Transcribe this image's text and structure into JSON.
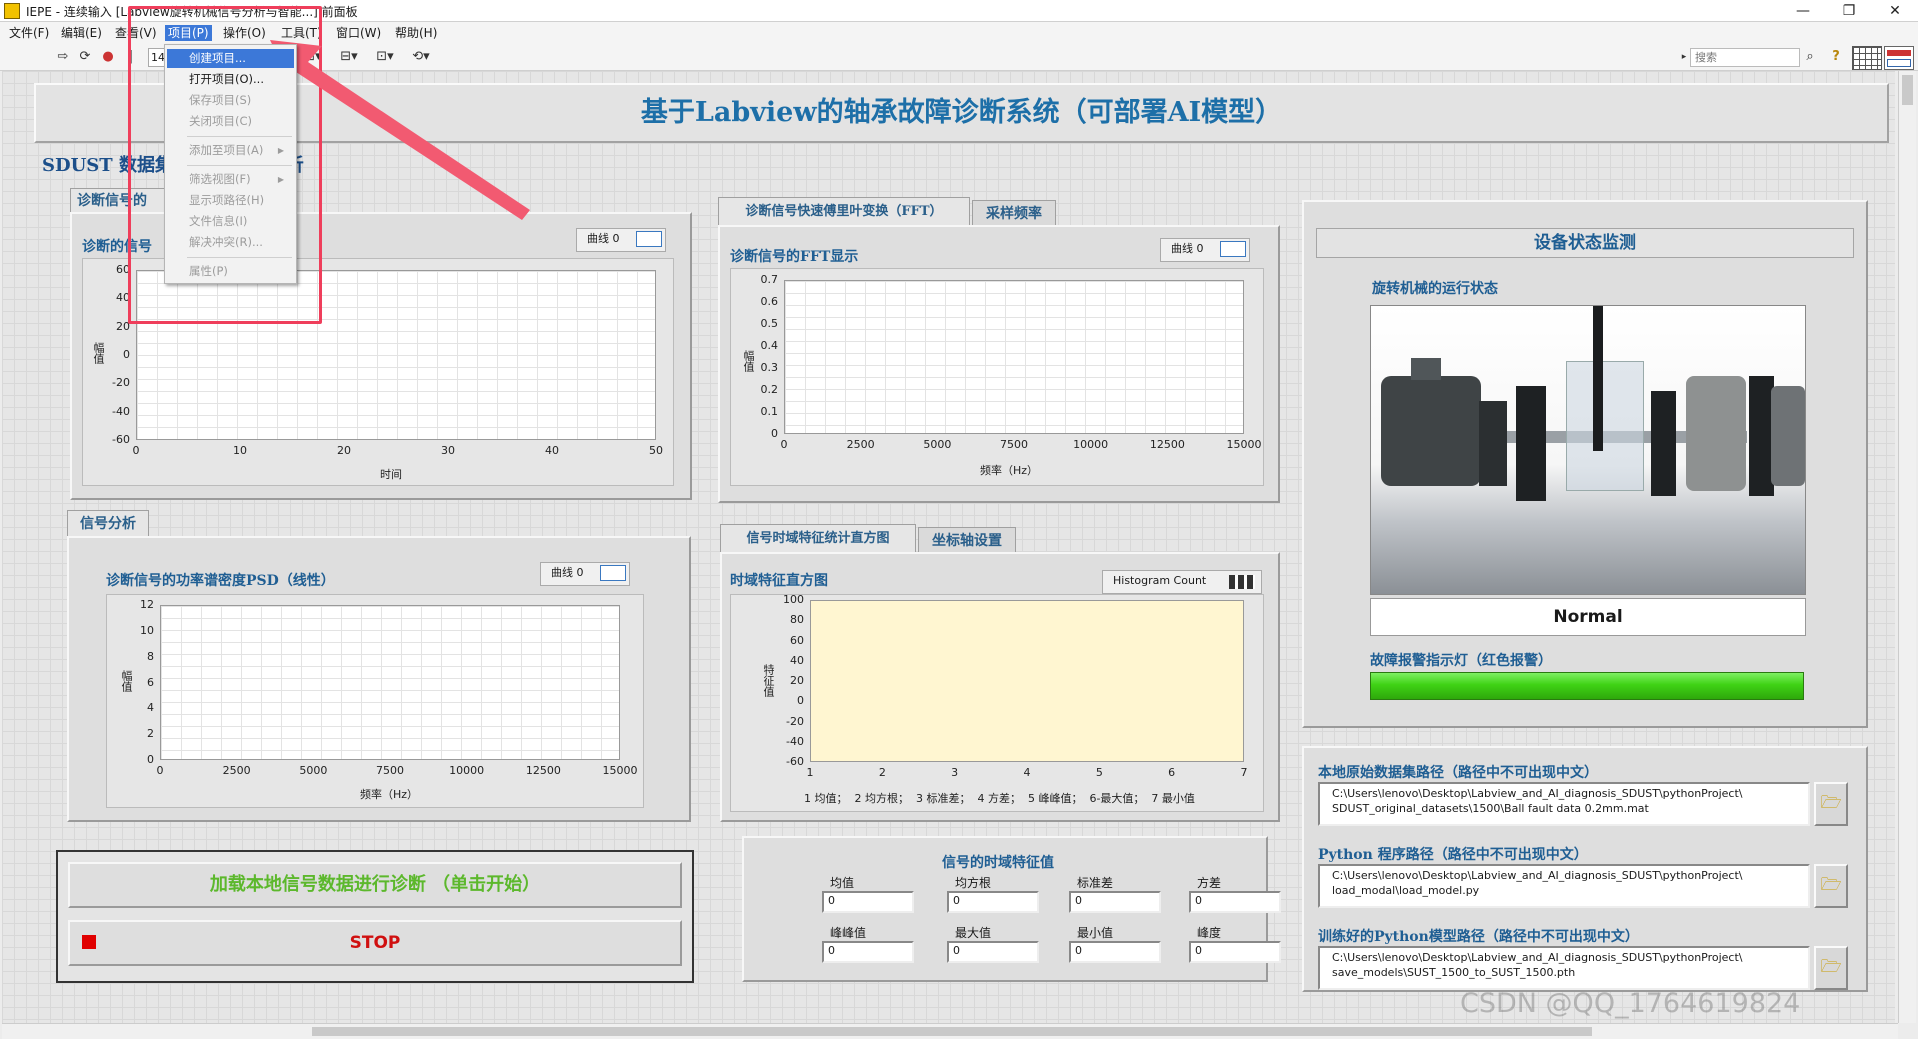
{
  "window": {
    "title": "IEPE - 连续输入 [Labview旋转机械信号分析与智能...] 前面板",
    "controls": [
      "—",
      "❐",
      "✕"
    ]
  },
  "menubar": {
    "items": [
      "文件(F)",
      "编辑(E)",
      "查看(V)",
      "项目(P)",
      "操作(O)",
      "工具(T)",
      "窗口(W)",
      "帮助(H)"
    ]
  },
  "toolbar": {
    "font_size_value": "14",
    "search_placeholder": "搜索",
    "help": "?"
  },
  "project_menu": {
    "items": [
      {
        "label": "创建项目...",
        "state": "highlighted"
      },
      {
        "label": "打开项目(O)...",
        "state": "enabled"
      },
      {
        "label": "保存项目(S)",
        "state": "disabled"
      },
      {
        "label": "关闭项目(C)",
        "state": "disabled"
      },
      {
        "label": "添加至项目(A)",
        "state": "disabled",
        "submenu": true
      },
      {
        "label": "筛选视图(F)",
        "state": "disabled",
        "submenu": true
      },
      {
        "label": "显示项路径(H)",
        "state": "disabled"
      },
      {
        "label": "文件信息(I)",
        "state": "disabled"
      },
      {
        "label": "解决冲突(R)...",
        "state": "disabled"
      },
      {
        "label": "属性(P)",
        "state": "disabled"
      }
    ]
  },
  "banner": {
    "title": "基于Labview的轴承故障诊断系统（可部署AI模型）"
  },
  "section_label": "SDUST 数据集                  析",
  "left_panel": {
    "tab_label": "诊断信号的",
    "chart_title": "诊断的信号",
    "legend": "曲线 0",
    "y_label": "幅值",
    "x_label": "时间"
  },
  "fft_panel": {
    "tabs": [
      "诊断信号快速傅里叶变换（FFT）",
      "采样频率"
    ],
    "chart_title": "诊断信号的FFT显示",
    "legend": "曲线 0",
    "y_label": "幅值",
    "x_label": "频率（Hz）"
  },
  "psd_panel": {
    "tab_label": "信号分析",
    "chart_title": "诊断信号的功率谱密度PSD（线性）",
    "legend": "曲线 0",
    "y_label": "幅值",
    "x_label": "频率（Hz）"
  },
  "hist_panel": {
    "tabs": [
      "信号时域特征统计直方图",
      "坐标轴设置"
    ],
    "chart_title": "时域特征直方图",
    "legend": "Histogram Count",
    "y_label": "特征值",
    "x_names": "1 均值；  2 均方根；  3 标准差；  4 方差；  5 峰峰值；  6-最大值；  7 最小值"
  },
  "action": {
    "load_button": "加载本地信号数据进行诊断 （单击开始）",
    "stop_button": "STOP"
  },
  "features": {
    "title": "信号的时域特征值",
    "fields": [
      {
        "label": "均值",
        "value": "0"
      },
      {
        "label": "均方根",
        "value": "0"
      },
      {
        "label": "标准差",
        "value": "0"
      },
      {
        "label": "方差",
        "value": "0"
      },
      {
        "label": "峰峰值",
        "value": "0"
      },
      {
        "label": "最大值",
        "value": "0"
      },
      {
        "label": "最小值",
        "value": "0"
      },
      {
        "label": "峰度",
        "value": "0"
      }
    ]
  },
  "monitor": {
    "title": "设备状态监测",
    "subtitle": "旋转机械的运行状态",
    "status": "Normal",
    "alarm_label": "故障报警指示灯（红色报警）",
    "alarm_color": "#3fd215"
  },
  "paths": [
    {
      "label": "本地原始数据集路径（路径中不可出现中文）",
      "line1": "C:\\Users\\lenovo\\Desktop\\Labview_and_AI_diagnosis_SDUST\\pythonProject\\",
      "line2": "SDUST_original_datasets\\1500\\Ball fault data 0.2mm.mat"
    },
    {
      "label": "Python 程序路径（路径中不可出现中文）",
      "line1": "C:\\Users\\lenovo\\Desktop\\Labview_and_AI_diagnosis_SDUST\\pythonProject\\",
      "line2": "load_modal\\load_model.py"
    },
    {
      "label": "训练好的Python模型路径（路径中不可出现中文）",
      "line1": "C:\\Users\\lenovo\\Desktop\\Labview_and_AI_diagnosis_SDUST\\pythonProject\\",
      "line2": "save_models\\SUST_1500_to_SUST_1500.pth"
    }
  ],
  "watermark": "CSDN @QQ_1764619824",
  "chart_data": [
    {
      "type": "line",
      "name": "time",
      "title": "诊断的信号",
      "series": [],
      "xlim": [
        0,
        50
      ],
      "ylim": [
        -60,
        60
      ],
      "x_ticks": [
        "0",
        "10",
        "20",
        "30",
        "40",
        "50"
      ],
      "y_ticks": [
        "60",
        "40",
        "20",
        "0",
        "-20",
        "-40",
        "-60"
      ],
      "xlabel": "时间",
      "ylabel": "幅值"
    },
    {
      "type": "line",
      "name": "fft",
      "title": "诊断信号的FFT显示",
      "series": [],
      "xlim": [
        0,
        15000
      ],
      "ylim": [
        0,
        0.7
      ],
      "x_ticks": [
        "0",
        "2500",
        "5000",
        "7500",
        "10000",
        "12500",
        "15000"
      ],
      "y_ticks": [
        "0.7",
        "0.6",
        "0.5",
        "0.4",
        "0.3",
        "0.2",
        "0.1",
        "0"
      ],
      "xlabel": "频率（Hz）",
      "ylabel": "幅值"
    },
    {
      "type": "line",
      "name": "psd",
      "title": "诊断信号的功率谱密度PSD（线性）",
      "series": [],
      "xlim": [
        0,
        15000
      ],
      "ylim": [
        0,
        12
      ],
      "x_ticks": [
        "0",
        "2500",
        "5000",
        "7500",
        "10000",
        "12500",
        "15000"
      ],
      "y_ticks": [
        "12",
        "10",
        "8",
        "6",
        "4",
        "2",
        "0"
      ],
      "xlabel": "频率（Hz）",
      "ylabel": "幅值"
    },
    {
      "type": "bar",
      "name": "hist",
      "title": "时域特征直方图",
      "categories": [
        "1",
        "2",
        "3",
        "4",
        "5",
        "6",
        "7"
      ],
      "values": [],
      "ylim": [
        -60,
        100
      ],
      "y_ticks": [
        "100",
        "80",
        "60",
        "40",
        "20",
        "0",
        "-20",
        "-40",
        "-60"
      ],
      "ylabel": "特征值"
    }
  ]
}
